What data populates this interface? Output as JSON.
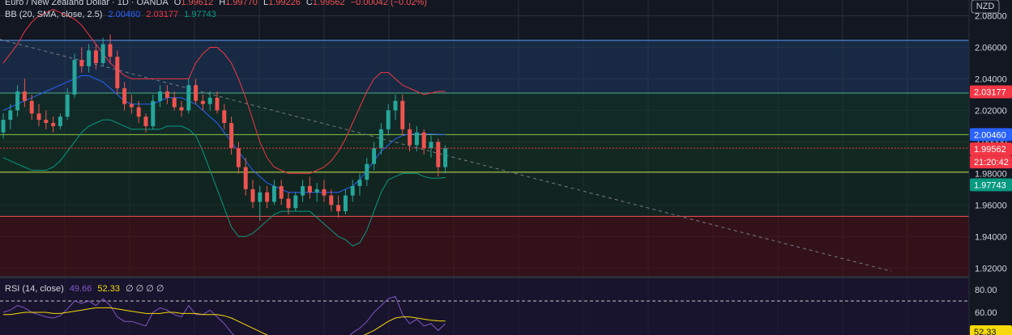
{
  "header": {
    "symbol_line": "Euro / New Zealand Dollar · 1D · OANDA",
    "open_label": "O",
    "open": "1.99612",
    "high_label": "H",
    "high": "1.99770",
    "low_label": "L",
    "low": "1.99226",
    "close_label": "C",
    "close": "1.99562",
    "change": "−0.00042 (−0.02%)"
  },
  "bb_legend": {
    "title": "BB (20, SMA, close, 2.5)",
    "basis": "2.00460",
    "upper": "2.03177",
    "lower": "1.97743"
  },
  "rsi_legend": {
    "title": "RSI (14, close)",
    "rsi": "49.66",
    "ma": "52.33",
    "extras": "∅ ∅ ∅ ∅"
  },
  "currency": "NZD",
  "price_axis": {
    "ticks": [
      "2.08000",
      "2.06000",
      "2.04000",
      "2.02000",
      "2.00000",
      "1.98000",
      "1.96000",
      "1.94000",
      "1.92000"
    ]
  },
  "rsi_axis": {
    "ticks": [
      "80.00",
      "60.00"
    ]
  },
  "badges": {
    "upper": {
      "value": "2.03177",
      "color": "#f23645"
    },
    "basis": {
      "value": "2.00460",
      "color": "#2962ff"
    },
    "price": {
      "value": "1.99562",
      "color": "#f23645"
    },
    "countdown": {
      "value": "21:20:42",
      "color": "#f23645"
    },
    "lower": {
      "value": "1.97743",
      "color": "#089981"
    },
    "rsi_ma": {
      "value": "52.33",
      "color": "#f5d90a"
    }
  },
  "colors": {
    "up": "#26a69a",
    "down": "#ef5350",
    "bb_upper": "#f23645",
    "bb_basis": "#2962ff",
    "bb_lower": "#089981",
    "rsi": "#7e57c2",
    "rsi_ma": "#f5d90a",
    "fill_blue": "#1e3a5f",
    "fill_green": "#0f3d2a",
    "fill_red": "#4a0d12"
  },
  "chart_data": {
    "type": "candlestick",
    "ylim": [
      1.915,
      2.09
    ],
    "horizontal_levels": [
      2.0644,
      2.031,
      2.0046,
      1.9808,
      1.9528
    ],
    "candles": [
      [
        2.006,
        2.018,
        2.002,
        2.014
      ],
      [
        2.014,
        2.024,
        2.008,
        2.02
      ],
      [
        2.02,
        2.036,
        2.016,
        2.032
      ],
      [
        2.032,
        2.04,
        2.022,
        2.026
      ],
      [
        2.026,
        2.03,
        2.014,
        2.018
      ],
      [
        2.018,
        2.024,
        2.01,
        2.014
      ],
      [
        2.014,
        2.02,
        2.008,
        2.012
      ],
      [
        2.012,
        2.016,
        2.006,
        2.01
      ],
      [
        2.01,
        2.018,
        2.008,
        2.016
      ],
      [
        2.016,
        2.034,
        2.014,
        2.03
      ],
      [
        2.03,
        2.056,
        2.028,
        2.052
      ],
      [
        2.052,
        2.06,
        2.044,
        2.048
      ],
      [
        2.048,
        2.062,
        2.044,
        2.058
      ],
      [
        2.058,
        2.062,
        2.046,
        2.05
      ],
      [
        2.05,
        2.066,
        2.048,
        2.062
      ],
      [
        2.062,
        2.068,
        2.05,
        2.054
      ],
      [
        2.054,
        2.058,
        2.03,
        2.034
      ],
      [
        2.034,
        2.038,
        2.02,
        2.024
      ],
      [
        2.024,
        2.03,
        2.018,
        2.022
      ],
      [
        2.022,
        2.026,
        2.012,
        2.016
      ],
      [
        2.016,
        2.018,
        2.006,
        2.01
      ],
      [
        2.01,
        2.03,
        2.008,
        2.026
      ],
      [
        2.026,
        2.036,
        2.022,
        2.032
      ],
      [
        2.032,
        2.036,
        2.024,
        2.028
      ],
      [
        2.028,
        2.032,
        2.02,
        2.022
      ],
      [
        2.022,
        2.026,
        2.016,
        2.02
      ],
      [
        2.02,
        2.04,
        2.018,
        2.036
      ],
      [
        2.036,
        2.04,
        2.024,
        2.026
      ],
      [
        2.026,
        2.03,
        2.02,
        2.024
      ],
      [
        2.024,
        2.032,
        2.02,
        2.028
      ],
      [
        2.028,
        2.032,
        2.018,
        2.02
      ],
      [
        2.02,
        2.024,
        2.008,
        2.012
      ],
      [
        2.012,
        2.016,
        1.992,
        1.996
      ],
      [
        1.996,
        2.0,
        1.98,
        1.984
      ],
      [
        1.984,
        1.99,
        1.966,
        1.97
      ],
      [
        1.97,
        1.976,
        1.958,
        1.962
      ],
      [
        1.962,
        1.972,
        1.95,
        1.968
      ],
      [
        1.968,
        1.972,
        1.958,
        1.962
      ],
      [
        1.962,
        1.976,
        1.96,
        1.972
      ],
      [
        1.972,
        1.976,
        1.96,
        1.964
      ],
      [
        1.964,
        1.968,
        1.954,
        1.958
      ],
      [
        1.958,
        1.968,
        1.956,
        1.966
      ],
      [
        1.966,
        1.976,
        1.962,
        1.972
      ],
      [
        1.972,
        1.978,
        1.964,
        1.968
      ],
      [
        1.968,
        1.974,
        1.962,
        1.97
      ],
      [
        1.97,
        1.976,
        1.962,
        1.966
      ],
      [
        1.966,
        1.97,
        1.956,
        1.96
      ],
      [
        1.96,
        1.966,
        1.952,
        1.956
      ],
      [
        1.956,
        1.97,
        1.954,
        1.966
      ],
      [
        1.966,
        1.976,
        1.962,
        1.972
      ],
      [
        1.972,
        1.98,
        1.966,
        1.976
      ],
      [
        1.976,
        1.99,
        1.972,
        1.986
      ],
      [
        1.986,
        2.0,
        1.982,
        1.996
      ],
      [
        1.996,
        2.012,
        1.992,
        2.008
      ],
      [
        2.008,
        2.024,
        2.004,
        2.02
      ],
      [
        2.02,
        2.03,
        2.014,
        2.026
      ],
      [
        2.026,
        2.03,
        2.004,
        2.008
      ],
      [
        2.008,
        2.012,
        1.994,
        1.998
      ],
      [
        1.998,
        2.01,
        1.994,
        2.006
      ],
      [
        2.006,
        2.008,
        1.992,
        1.996
      ],
      [
        1.996,
        2.004,
        1.99,
        2.0
      ],
      [
        2.0,
        2.002,
        1.978,
        1.984
      ],
      [
        1.984,
        1.998,
        1.98,
        1.996
      ]
    ],
    "bb_upper": [
      2.05,
      2.056,
      2.062,
      2.07,
      2.076,
      2.08,
      2.082,
      2.084,
      2.082,
      2.08,
      2.078,
      2.074,
      2.068,
      2.062,
      2.056,
      2.05,
      2.046,
      2.042,
      2.04,
      2.04,
      2.04,
      2.04,
      2.04,
      2.04,
      2.04,
      2.04,
      2.04,
      2.05,
      2.056,
      2.06,
      2.06,
      2.056,
      2.05,
      2.04,
      2.028,
      2.014,
      2.0,
      1.99,
      1.984,
      1.982,
      1.98,
      1.98,
      1.98,
      1.98,
      1.982,
      1.984,
      1.988,
      1.994,
      2.002,
      2.012,
      2.022,
      2.032,
      2.04,
      2.044,
      2.044,
      2.04,
      2.036,
      2.034,
      2.032,
      2.03,
      2.031,
      2.032,
      2.032
    ],
    "bb_basis": [
      2.02,
      2.022,
      2.024,
      2.026,
      2.028,
      2.03,
      2.032,
      2.034,
      2.036,
      2.038,
      2.04,
      2.042,
      2.042,
      2.04,
      2.038,
      2.034,
      2.03,
      2.026,
      2.024,
      2.024,
      2.024,
      2.024,
      2.026,
      2.028,
      2.028,
      2.028,
      2.026,
      2.024,
      2.02,
      2.016,
      2.012,
      2.006,
      2.0,
      1.994,
      1.988,
      1.982,
      1.978,
      1.974,
      1.972,
      1.97,
      1.968,
      1.968,
      1.968,
      1.968,
      1.968,
      1.968,
      1.968,
      1.968,
      1.97,
      1.972,
      1.976,
      1.982,
      1.988,
      1.994,
      1.998,
      2.002,
      2.004,
      2.005,
      2.005,
      2.005,
      2.005,
      2.0048,
      2.0046
    ],
    "bb_lower": [
      1.99,
      1.988,
      1.986,
      1.984,
      1.982,
      1.982,
      1.982,
      1.984,
      1.988,
      1.994,
      2.0,
      2.006,
      2.01,
      2.012,
      2.014,
      2.014,
      2.012,
      2.01,
      2.008,
      2.008,
      2.008,
      2.008,
      2.008,
      2.01,
      2.01,
      2.01,
      2.008,
      2.004,
      1.994,
      1.982,
      1.97,
      1.958,
      1.946,
      1.94,
      1.94,
      1.942,
      1.946,
      1.95,
      1.954,
      1.956,
      1.956,
      1.956,
      1.956,
      1.956,
      1.952,
      1.948,
      1.944,
      1.94,
      1.938,
      1.934,
      1.936,
      1.944,
      1.956,
      1.968,
      1.976,
      1.978,
      1.98,
      1.98,
      1.98,
      1.978,
      1.977,
      1.977,
      1.9774
    ],
    "rsi": [
      60,
      62,
      66,
      64,
      60,
      58,
      56,
      55,
      57,
      63,
      70,
      68,
      70,
      66,
      72,
      66,
      56,
      52,
      52,
      50,
      48,
      60,
      64,
      62,
      58,
      56,
      66,
      58,
      58,
      62,
      56,
      50,
      42,
      36,
      30,
      28,
      32,
      30,
      36,
      32,
      30,
      34,
      38,
      36,
      38,
      36,
      32,
      30,
      36,
      42,
      46,
      52,
      60,
      66,
      72,
      74,
      58,
      50,
      54,
      48,
      50,
      44,
      50
    ],
    "rsi_ma": [
      58,
      58,
      59,
      60,
      60,
      60,
      60,
      59,
      59,
      60,
      61,
      62,
      63,
      64,
      64,
      64,
      63,
      62,
      61,
      60,
      59,
      59,
      59,
      60,
      60,
      59,
      59,
      59,
      58,
      58,
      58,
      57,
      55,
      52,
      49,
      46,
      43,
      40,
      38,
      36,
      34,
      33,
      33,
      33,
      33,
      34,
      34,
      34,
      35,
      36,
      38,
      41,
      44,
      48,
      52,
      55,
      56,
      56,
      55,
      54,
      53,
      52.5,
      52.33
    ],
    "rsi_ylim": [
      40,
      90
    ],
    "rsi_levels": [
      70
    ]
  }
}
